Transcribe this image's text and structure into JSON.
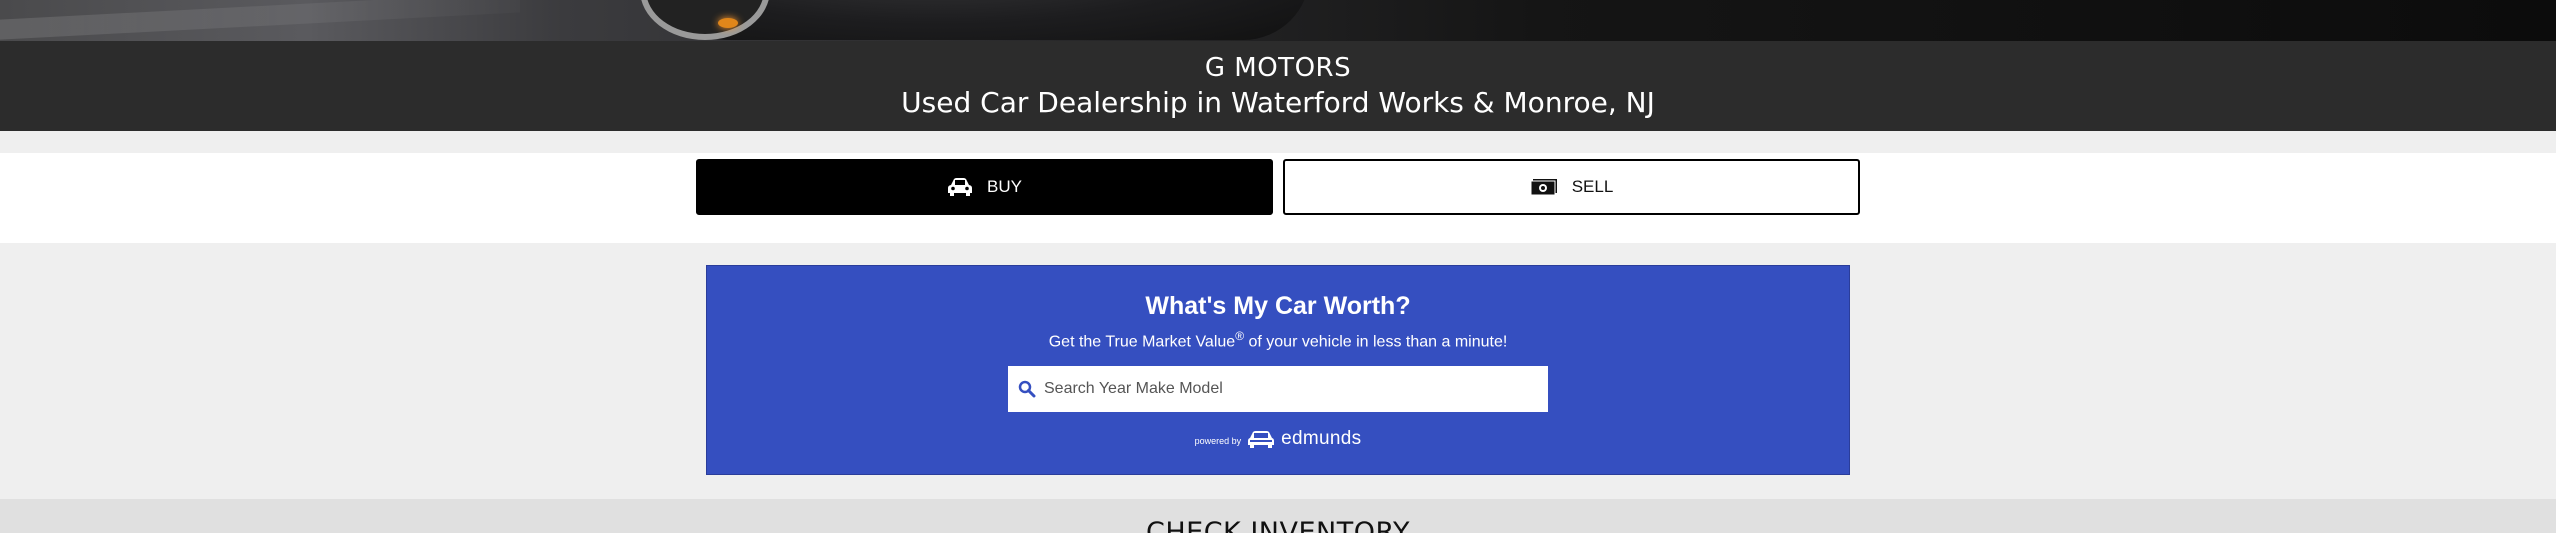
{
  "banner": {
    "title": "G MOTORS",
    "subtitle": "Used Car Dealership in Waterford Works & Monroe, NJ"
  },
  "toggle": {
    "buy_label": "BUY",
    "sell_label": "SELL",
    "buy_icon": "car-icon",
    "sell_icon": "cash-icon"
  },
  "appraisal_widget": {
    "title": "What's My Car Worth?",
    "subtitle_start": "Get the True Market Value",
    "subtitle_mark": "®",
    "subtitle_end": " of your vehicle in less than a minute!",
    "search_placeholder": "Search Year Make Model",
    "search_value": "",
    "powered_by": "powered by",
    "brand": "edmunds",
    "background_color": "#354fc0"
  },
  "inventory": {
    "title": "CHECK INVENTORY"
  },
  "colors": {
    "banner_bg": "#2c2c2c",
    "buy_bg": "#000000",
    "sell_bg": "#ffffff",
    "page_bg": "#efefef"
  }
}
